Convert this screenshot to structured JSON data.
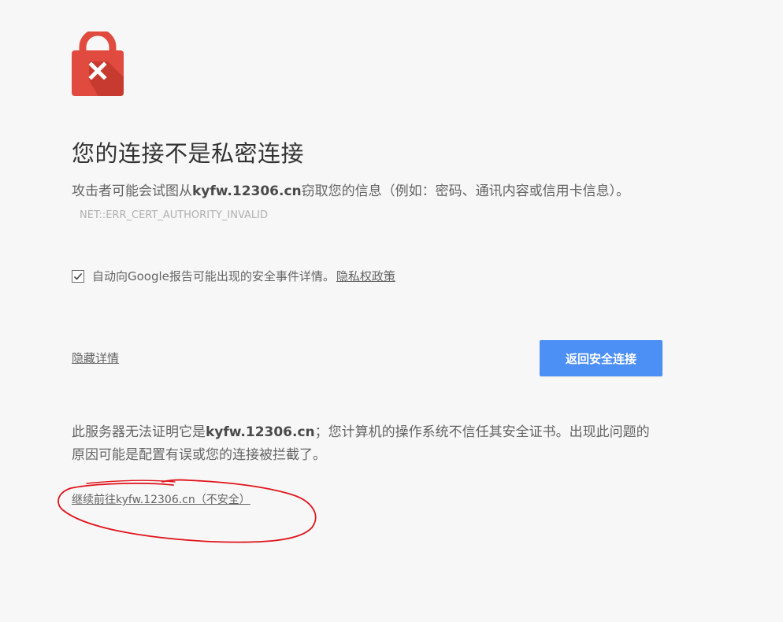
{
  "icon": {
    "name": "lock-error-icon",
    "color": "#e14b3f"
  },
  "heading": "您的连接不是私密连接",
  "message": {
    "prefix": "攻击者可能会试图从",
    "host": "kyfw.12306.cn",
    "suffix": "窃取您的信息（例如：密码、通讯内容或信用卡信息）。",
    "error_code": "NET::ERR_CERT_AUTHORITY_INVALID"
  },
  "report": {
    "checked": true,
    "label": "自动向Google报告可能出现的安全事件详情。",
    "privacy_link": "隐私权政策"
  },
  "actions": {
    "hide_details": "隐藏详情",
    "back_button": "返回安全连接",
    "button_color": "#4c8ff5"
  },
  "details": {
    "prefix": "此服务器无法证明它是",
    "host": "kyfw.12306.cn",
    "suffix": "；您计算机的操作系统不信任其安全证书。出现此问题的原因可能是配置有误或您的连接被拦截了。"
  },
  "proceed_link": "继续前往kyfw.12306.cn（不安全）",
  "annotation_color": "#e0131a"
}
